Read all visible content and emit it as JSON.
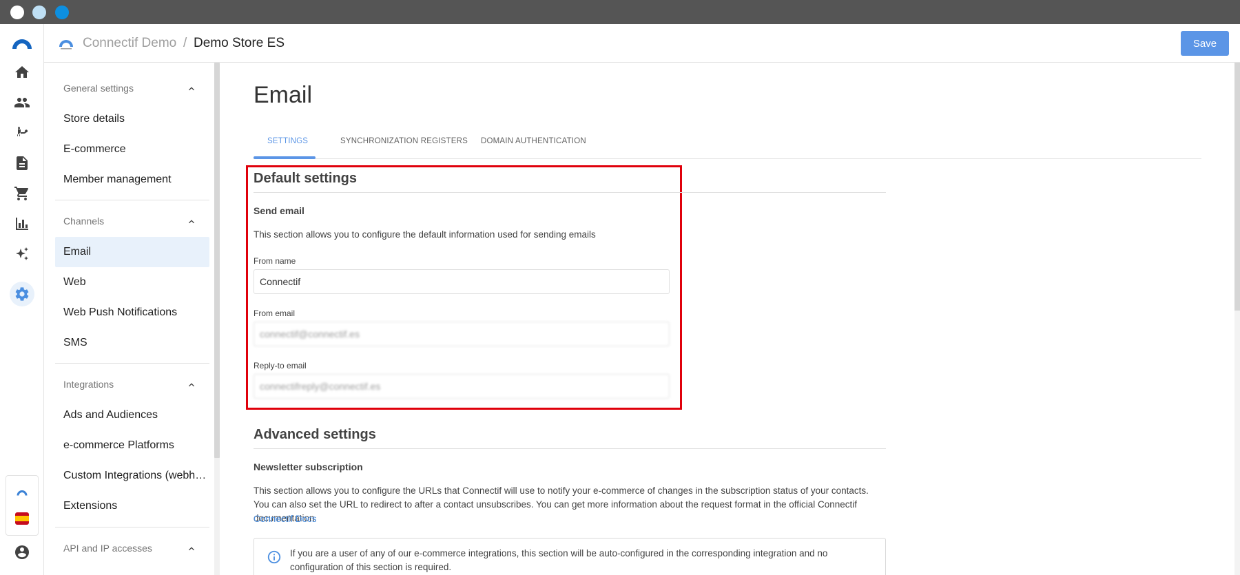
{
  "header": {
    "org_name": "Connectif Demo",
    "separator": "/",
    "store_name": "Demo Store ES",
    "save_label": "Save"
  },
  "rail": {
    "icons": [
      "home-icon",
      "contacts-icon",
      "workflow-icon",
      "content-icon",
      "cart-icon",
      "reports-icon",
      "ai-sparkle-icon",
      "settings-icon"
    ],
    "active": "settings-icon",
    "flag": "spain-flag-icon"
  },
  "sidebar": {
    "sections": [
      {
        "title": "General settings",
        "items": [
          "Store details",
          "E-commerce",
          "Member management"
        ]
      },
      {
        "title": "Channels",
        "items": [
          "Email",
          "Web",
          "Web Push Notifications",
          "SMS"
        ]
      },
      {
        "title": "Integrations",
        "items": [
          "Ads and Audiences",
          "e-commerce Platforms",
          "Custom Integrations (webhooks)",
          "Extensions"
        ]
      },
      {
        "title": "API and IP accesses",
        "items": []
      }
    ],
    "active_item": "Email"
  },
  "main": {
    "title": "Email",
    "tabs": [
      "SETTINGS",
      "SYNCHRONIZATION REGISTERS",
      "DOMAIN AUTHENTICATION"
    ],
    "active_tab": "SETTINGS",
    "default_settings": {
      "heading": "Default settings",
      "subheading": "Send email",
      "description": "This section allows you to configure the default information used for sending emails",
      "from_name_label": "From name",
      "from_name_value": "Connectif",
      "from_email_label": "From email",
      "from_email_value": "connectif@connectif.es",
      "reply_to_label": "Reply-to email",
      "reply_to_value": "connectifreply@connectif.es"
    },
    "advanced_settings": {
      "heading": "Advanced settings",
      "subheading": "Newsletter subscription",
      "description": "This section allows you to configure the URLs that Connectif will use to notify your e-commerce of changes in the subscription status of your contacts. You can also set the URL to redirect to after a contact unsubscribes. You can get more information about the request format in the official Connectif documentation.",
      "link": "Connectif Docs",
      "info": "If you are a user of any of our e-commerce integrations, this section will be auto-configured in the corresponding integration and no configuration of this section is required."
    }
  },
  "colors": {
    "accent": "#5b95e6",
    "highlight": "#e0000b",
    "active_bg": "#e8f1fb"
  }
}
